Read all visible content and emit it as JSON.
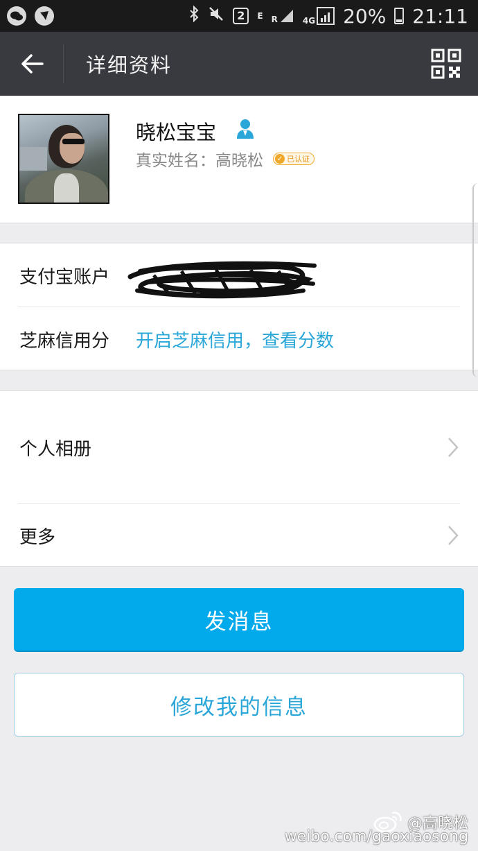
{
  "status_bar": {
    "sim_badge": "2",
    "net_e": "E",
    "net_r": "R",
    "net_4g": "4G",
    "battery_percent": "20%",
    "time": "21:11"
  },
  "header": {
    "title": "详细资料"
  },
  "profile": {
    "nickname": "晓松宝宝",
    "real_name_label": "真实姓名：",
    "real_name_value": "高晓松",
    "certified_badge": "已认证"
  },
  "alipay_group": {
    "account_label": "支付宝账户",
    "sesame_label": "芝麻信用分",
    "sesame_link": "开启芝麻信用，查看分数"
  },
  "list_group": {
    "album_label": "个人相册",
    "more_label": "更多"
  },
  "buttons": {
    "send_message": "发消息",
    "edit_info": "修改我的信息"
  },
  "watermark": {
    "handle": "@高晓松",
    "url": "weibo.com/gaoxiaosong"
  },
  "colors": {
    "header_bg": "#393a3f",
    "primary_button": "#03aaeb",
    "link": "#2aa6d8",
    "badge": "#f0a82a"
  }
}
